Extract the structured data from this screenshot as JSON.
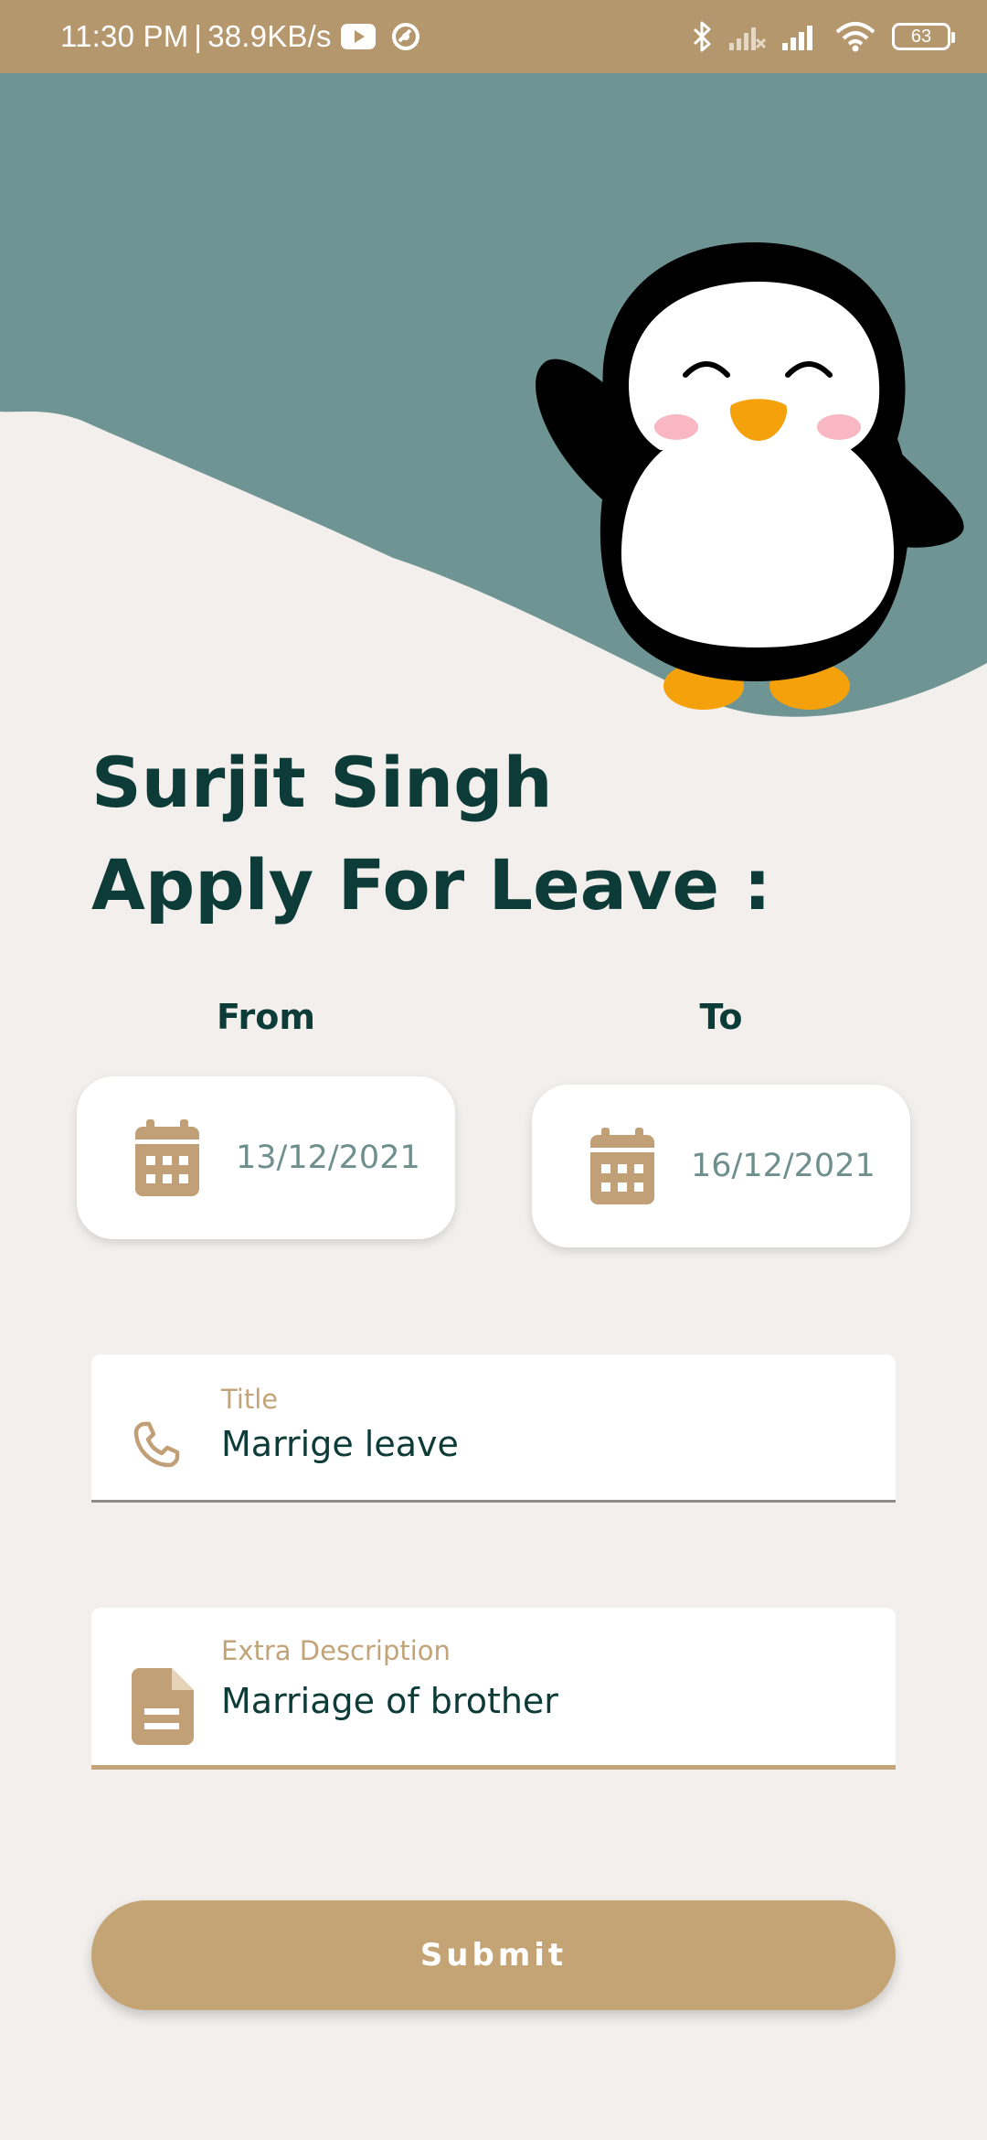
{
  "status_bar": {
    "time": "11:30 PM",
    "separator": "|",
    "network_speed": "38.9KB/s",
    "battery": "63",
    "icons": [
      "youtube-icon",
      "vpn-icon",
      "bluetooth-icon",
      "signal-off-icon",
      "signal-icon",
      "wifi-icon",
      "battery-icon"
    ]
  },
  "hero": {
    "background_color": "#6e9593",
    "illustration": "penguin-mascot"
  },
  "header": {
    "user_name": "Surjit Singh",
    "heading": "Apply For Leave :"
  },
  "dates": {
    "from_label": "From",
    "from_value": "13/12/2021",
    "to_label": "To",
    "to_value": "16/12/2021",
    "icon": "calendar-icon"
  },
  "title_field": {
    "label": "Title",
    "value": "Marrige leave",
    "icon": "phone-icon"
  },
  "description_field": {
    "label": "Extra Description",
    "value": "Marriage of brother",
    "icon": "document-icon"
  },
  "submit": {
    "label": "Submit"
  },
  "colors": {
    "accent": "#c4a475",
    "heading": "#0d3b38",
    "status_bar": "#b5976e",
    "background": "#f2efec"
  }
}
